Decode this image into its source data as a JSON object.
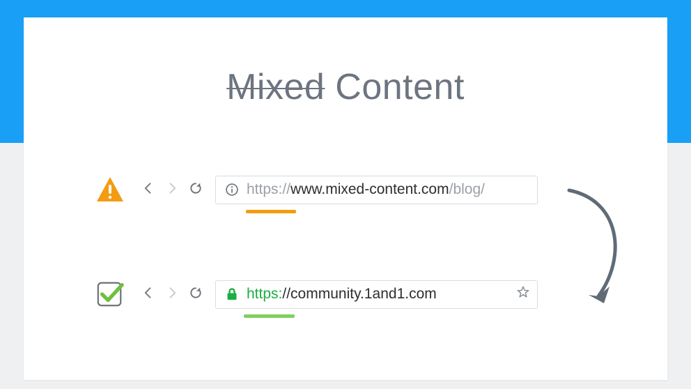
{
  "title": {
    "strike": "Mixed",
    "rest": "Content"
  },
  "colors": {
    "brand_blue": "#199ff5",
    "warn_orange": "#f39c12",
    "ok_green": "#1aae43",
    "nav_gray": "#9aa0a6",
    "arrow_gray": "#606b76",
    "underline_orange": "#f29d0c",
    "underline_green": "#80cf5d"
  },
  "top": {
    "status_icon": "warning-triangle",
    "url": {
      "scheme": "https://",
      "main": "www.mixed-content.com",
      "path": "/blog/"
    }
  },
  "bottom": {
    "status_icon": "check-outline",
    "url": {
      "scheme": "https:",
      "sep": "//",
      "main": "community.1and1.com"
    }
  }
}
